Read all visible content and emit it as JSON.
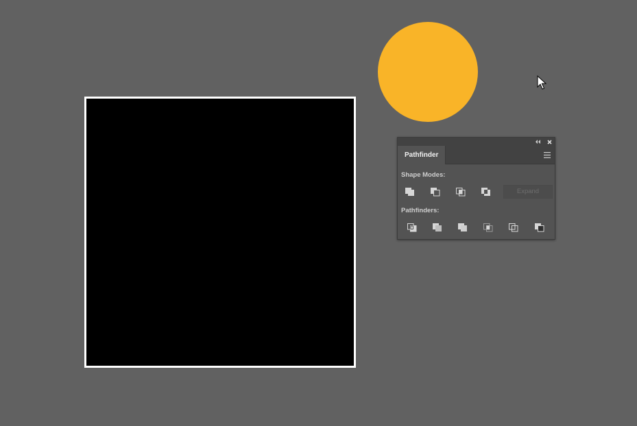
{
  "artboard": {
    "background_color": "#616161"
  },
  "objects": {
    "square": {
      "fill": "#000000",
      "stroke": "#ffffff"
    },
    "circle": {
      "fill": "#f9b428"
    }
  },
  "pathfinder_panel": {
    "tab_label": "Pathfinder",
    "shape_modes_label": "Shape Modes:",
    "pathfinders_label": "Pathfinders:",
    "expand_label": "Expand",
    "shape_mode_icons": [
      "unite-icon",
      "minus-front-icon",
      "intersect-icon",
      "exclude-icon"
    ],
    "pathfinder_icons": [
      "divide-icon",
      "trim-icon",
      "merge-icon",
      "crop-icon",
      "outline-icon",
      "minus-back-icon"
    ],
    "titlebar_icons": [
      "collapse-icon",
      "close-icon"
    ],
    "menu_icon": "panel-menu-icon"
  }
}
